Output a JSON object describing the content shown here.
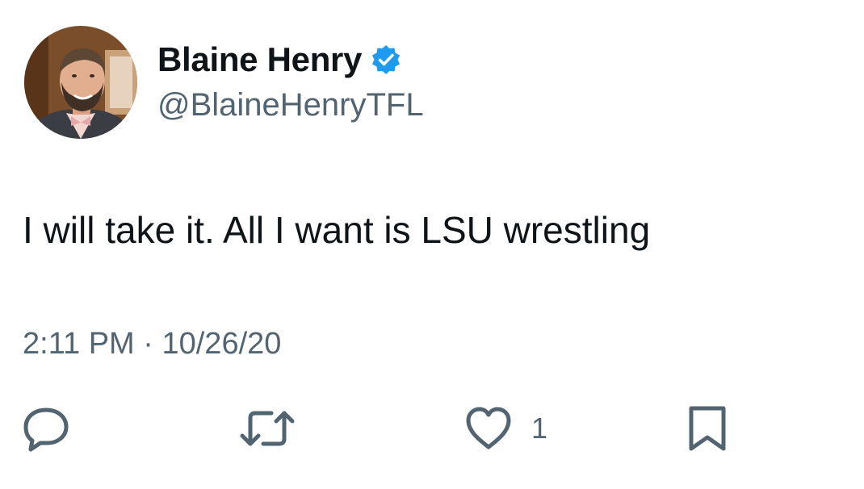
{
  "author": {
    "display_name": "Blaine Henry",
    "handle": "@BlaineHenryTFL",
    "verified": true,
    "avatar_icon": "profile-photo"
  },
  "tweet": {
    "text": "I will take it. All I want is LSU wrestling",
    "time": "2:11 PM",
    "separator": "·",
    "date": "10/26/20"
  },
  "actions": {
    "reply_icon": "speech-bubble-icon",
    "retweet_icon": "retweet-arrows-icon",
    "like_icon": "heart-icon",
    "like_count": "1",
    "bookmark_icon": "bookmark-icon"
  },
  "colors": {
    "text_primary": "#0f1419",
    "text_secondary": "#536471",
    "verified_blue": "#1d9bf0",
    "background": "#ffffff"
  }
}
